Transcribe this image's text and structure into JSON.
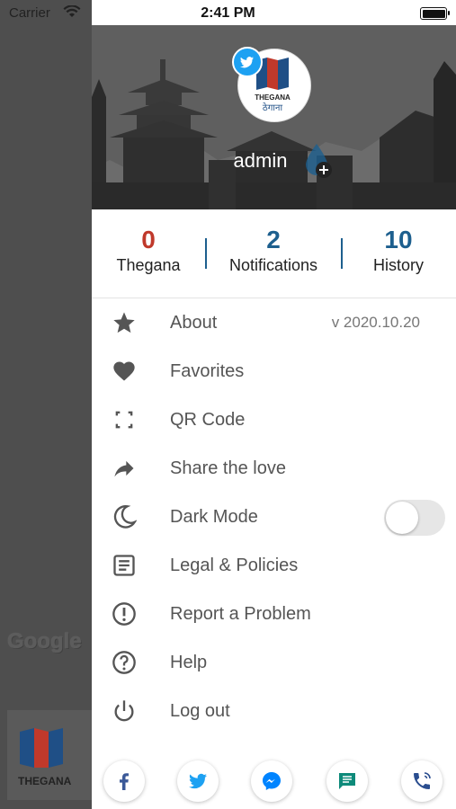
{
  "status": {
    "carrier": "Carrier",
    "time": "2:41 PM"
  },
  "background": {
    "map_logo": "Google",
    "card_brand": "THEGANA"
  },
  "header": {
    "username": "admin",
    "avatar_brand": "THEGANA",
    "avatar_brand_devanagari": "ठेगाना"
  },
  "stats": [
    {
      "value": "0",
      "label": "Thegana",
      "color": "#c0392b"
    },
    {
      "value": "2",
      "label": "Notifications",
      "color": "#1d5f8e"
    },
    {
      "value": "10",
      "label": "History",
      "color": "#1d5f8e"
    }
  ],
  "menu": {
    "about": {
      "label": "About",
      "version": "v 2020.10.20",
      "icon": "star-icon"
    },
    "favorites": {
      "label": "Favorites",
      "icon": "heart-icon"
    },
    "qr": {
      "label": "QR Code",
      "icon": "qr-frame-icon"
    },
    "share": {
      "label": "Share the love",
      "icon": "share-arrow-icon"
    },
    "dark": {
      "label": "Dark Mode",
      "icon": "moon-icon",
      "enabled": false
    },
    "legal": {
      "label": "Legal & Policies",
      "icon": "document-icon"
    },
    "report": {
      "label": "Report a Problem",
      "icon": "alert-icon"
    },
    "help": {
      "label": "Help",
      "icon": "help-icon"
    },
    "logout": {
      "label": "Log out",
      "icon": "power-icon"
    }
  },
  "social": [
    "facebook-icon",
    "twitter-icon",
    "messenger-icon",
    "sms-icon",
    "phone-icon"
  ],
  "colors": {
    "facebook": "#3b5998",
    "twitter": "#1da1f2",
    "messenger": "#0084ff",
    "sms": "#0e8a7a",
    "phone": "#2a4d8f"
  }
}
